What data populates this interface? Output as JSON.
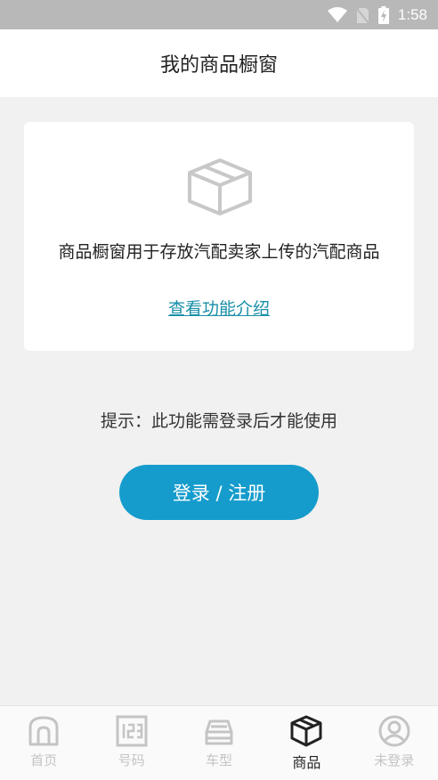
{
  "status_bar": {
    "time": "1:58",
    "icons": [
      "wifi-icon",
      "no-sim-icon",
      "battery-charging-icon"
    ]
  },
  "header": {
    "title": "我的商品橱窗"
  },
  "card": {
    "icon": "box-icon",
    "description": "商品橱窗用于存放汽配卖家上传的汽配商品",
    "link_label": "查看功能介绍"
  },
  "hint": "提示：此功能需登录后才能使用",
  "login_button": "登录 / 注册",
  "colors": {
    "accent": "#159ccc",
    "link": "#1a8fa8",
    "background": "#f1f1f1"
  },
  "tabs": [
    {
      "label": "首页",
      "icon": "home-icon",
      "active": false
    },
    {
      "label": "号码",
      "icon": "number-icon",
      "active": false
    },
    {
      "label": "车型",
      "icon": "car-icon",
      "active": false
    },
    {
      "label": "商品",
      "icon": "box-icon",
      "active": true
    },
    {
      "label": "未登录",
      "icon": "user-icon",
      "active": false
    }
  ]
}
